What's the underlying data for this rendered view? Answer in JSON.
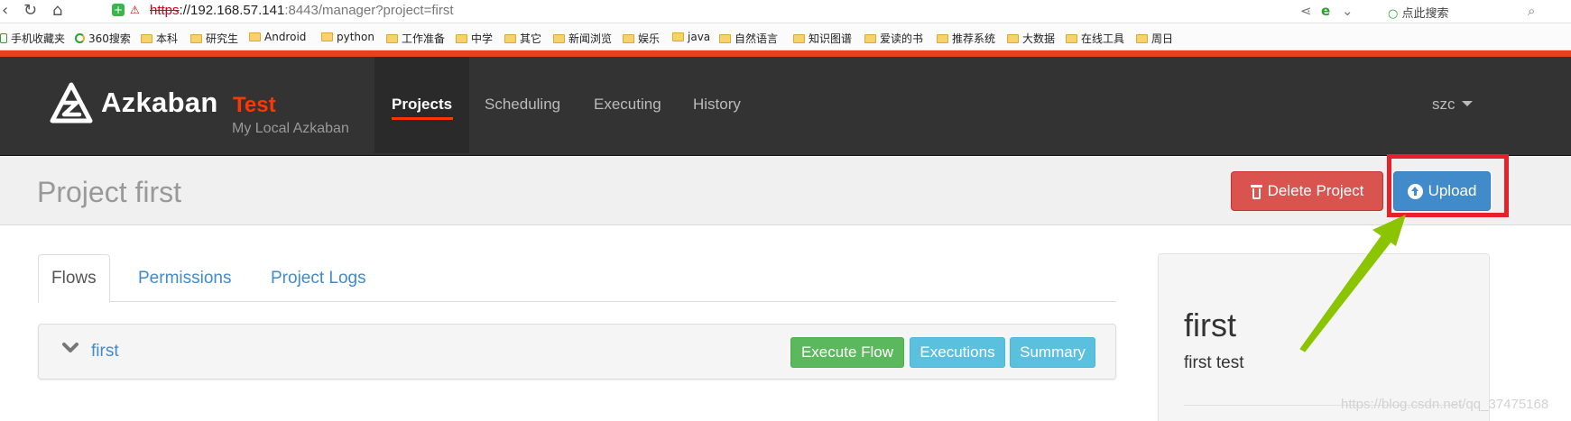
{
  "browser": {
    "url_proto": "https",
    "url_host": "://192.168.57.141",
    "url_path": ":8443/manager?project=first",
    "search_placeholder": "点此搜索",
    "bookmarks": [
      "手机收藏夹",
      "360搜索",
      "本科",
      "研究生",
      "Android",
      "python",
      "工作准备",
      "中学",
      "其它",
      "新闻浏览",
      "娱乐",
      "java",
      "自然语言",
      "知识图谱",
      "爱读的书",
      "推荐系统",
      "大数据",
      "在线工具",
      "周日"
    ]
  },
  "navbar": {
    "brand": "Azkaban",
    "env": "Test",
    "subtitle": "My Local Azkaban",
    "links": [
      "Projects",
      "Scheduling",
      "Executing",
      "History"
    ],
    "active_link": "Projects",
    "user": "szc"
  },
  "header": {
    "title": "Project first",
    "delete_label": "Delete Project",
    "upload_label": "Upload"
  },
  "tabs": [
    "Flows",
    "Permissions",
    "Project Logs"
  ],
  "flow": {
    "name": "first",
    "execute_label": "Execute Flow",
    "executions_label": "Executions",
    "summary_label": "Summary"
  },
  "project_info": {
    "name": "first",
    "description": "first test"
  },
  "watermark": "https://blog.csdn.net/qq_37475168",
  "colors": {
    "navbar_bg": "#333333",
    "brand_accent": "#ff3601",
    "danger": "#d9534f",
    "primary": "#428bca",
    "success": "#5cb85c",
    "info": "#5bc0de",
    "highlight_box": "#e8202a",
    "arrow": "#8bc400"
  }
}
